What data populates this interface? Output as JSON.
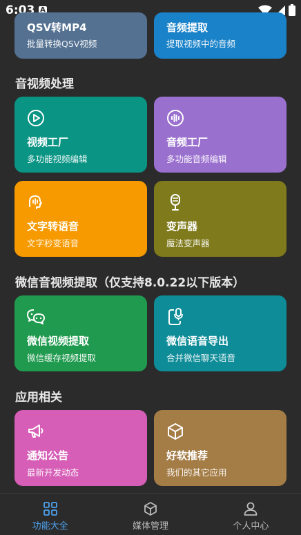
{
  "status": {
    "time": "6:03",
    "notif_letter": "A"
  },
  "colors": {
    "qsv": "#547191",
    "audio_extract": "#1a82c8",
    "video_factory": "#0a9484",
    "audio_factory": "#9a70cf",
    "text_to_speech": "#f79a00",
    "voice_changer": "#7f7a1c",
    "wechat_video": "#1f9a4e",
    "wechat_voice": "#0e8c98",
    "notice": "#d65eb7",
    "recommend": "#a47c46",
    "nav_active": "#4ea3f0",
    "nav_inactive": "#bbbbbb"
  },
  "top_cards": [
    {
      "title": "QSV转MP4",
      "subtitle": "批量转换QSV视频"
    },
    {
      "title": "音频提取",
      "subtitle": "提取视频中的音频"
    }
  ],
  "sections": [
    {
      "title": "音视频处理",
      "cards": [
        {
          "title": "视频工厂",
          "subtitle": "多功能视频编辑",
          "icon": "play-circle-icon"
        },
        {
          "title": "音频工厂",
          "subtitle": "多功能音频编辑",
          "icon": "audio-wave-icon"
        },
        {
          "title": "文字转语音",
          "subtitle": "文字秒变语音",
          "icon": "speaking-head-icon"
        },
        {
          "title": "变声器",
          "subtitle": "魔法变声器",
          "icon": "microphone-icon"
        }
      ]
    },
    {
      "title": "微信音视频提取（仅支持8.0.22以下版本）",
      "cards": [
        {
          "title": "微信视频提取",
          "subtitle": "微信缓存视频提取",
          "icon": "wechat-icon"
        },
        {
          "title": "微信语音导出",
          "subtitle": "合并微信聊天语音",
          "icon": "phone-mic-icon"
        }
      ]
    },
    {
      "title": "应用相关",
      "cards": [
        {
          "title": "通知公告",
          "subtitle": "最新开发动态",
          "icon": "megaphone-icon"
        },
        {
          "title": "好软推荐",
          "subtitle": "我们的其它应用",
          "icon": "cube-icon"
        }
      ]
    }
  ],
  "nav": [
    {
      "label": "功能大全",
      "icon": "grid-icon",
      "active": true
    },
    {
      "label": "媒体管理",
      "icon": "cube-icon",
      "active": false
    },
    {
      "label": "个人中心",
      "icon": "person-icon",
      "active": false
    }
  ]
}
